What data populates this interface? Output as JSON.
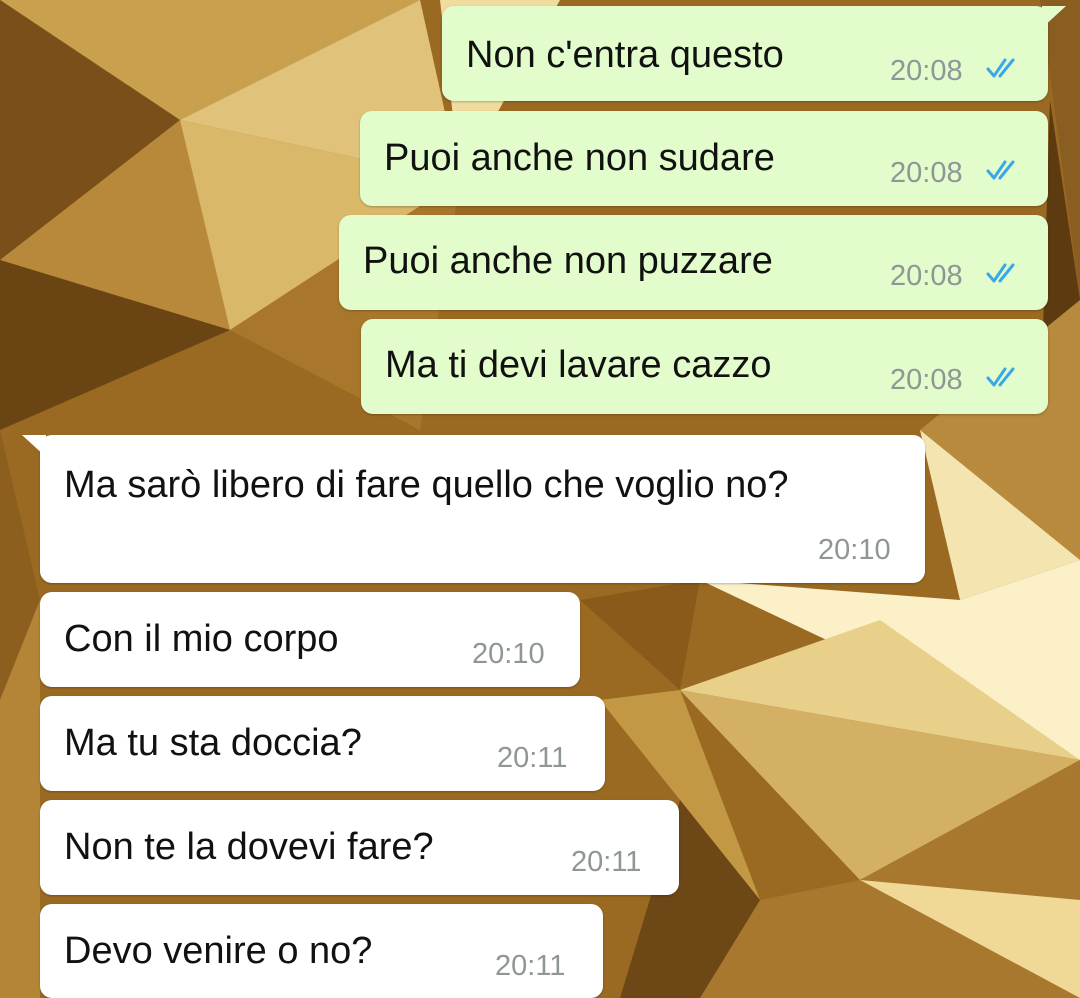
{
  "conversation": {
    "messages": [
      {
        "direction": "outgoing",
        "text": "Non c'entra questo",
        "time": "20:08",
        "status": "read"
      },
      {
        "direction": "outgoing",
        "text": "Puoi anche non sudare",
        "time": "20:08",
        "status": "read"
      },
      {
        "direction": "outgoing",
        "text": "Puoi anche non puzzare",
        "time": "20:08",
        "status": "read"
      },
      {
        "direction": "outgoing",
        "text": "Ma ti devi lavare cazzo",
        "time": "20:08",
        "status": "read"
      },
      {
        "direction": "incoming",
        "text": "Ma sarò libero di fare quello che voglio no?",
        "time": "20:10"
      },
      {
        "direction": "incoming",
        "text": "Con il mio corpo",
        "time": "20:10"
      },
      {
        "direction": "incoming",
        "text": "Ma tu sta doccia?",
        "time": "20:11"
      },
      {
        "direction": "incoming",
        "text": "Non te la dovevi fare?",
        "time": "20:11"
      },
      {
        "direction": "incoming",
        "text": "Devo venire o no?",
        "time": "20:11"
      }
    ]
  },
  "theme": {
    "outgoing_bubble": "#e2fccc",
    "incoming_bubble": "#ffffff",
    "read_ticks": "#3aa8e8",
    "timestamp": "#8f9796",
    "wallpaper": "gold-geometric"
  },
  "icons": {
    "read_receipt": "double-check-icon"
  }
}
